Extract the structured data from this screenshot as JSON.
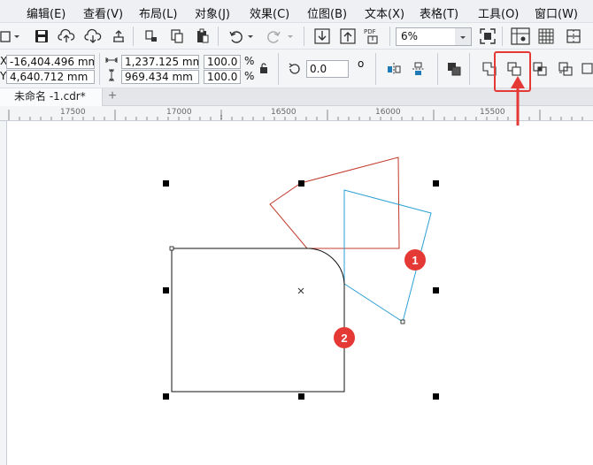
{
  "menu": [
    "编辑(E)",
    "查看(V)",
    "布局(L)",
    "对象(J)",
    "效果(C)",
    "位图(B)",
    "文本(X)",
    "表格(T)",
    "工具(O)",
    "窗口(W)"
  ],
  "toolbar": {
    "zoom_value": "6%",
    "pdf_label": "PDF"
  },
  "props": {
    "x_label": "X:",
    "x_value": "-16,404.496 mm",
    "y_label": "Y:",
    "y_value": "4,640.712 mm",
    "width_value": "1,237.125 mm",
    "height_value": "969.434 mm",
    "scale_w": "100.0",
    "scale_h": "100.0",
    "percent": "%",
    "rotation": "0.0",
    "degree": "o"
  },
  "tabs": {
    "document": "未命名 -1.cdr*",
    "add": "+"
  },
  "ruler": {
    "labels": [
      "17500",
      "17000",
      "16500",
      "16000",
      "15500"
    ]
  },
  "annotations": {
    "badge1": "1",
    "badge2": "2"
  },
  "colors": {
    "highlight": "#e53935",
    "red_shape": "#c0392b",
    "blue_shape": "#2a9fd6",
    "badge": "#e53935"
  }
}
